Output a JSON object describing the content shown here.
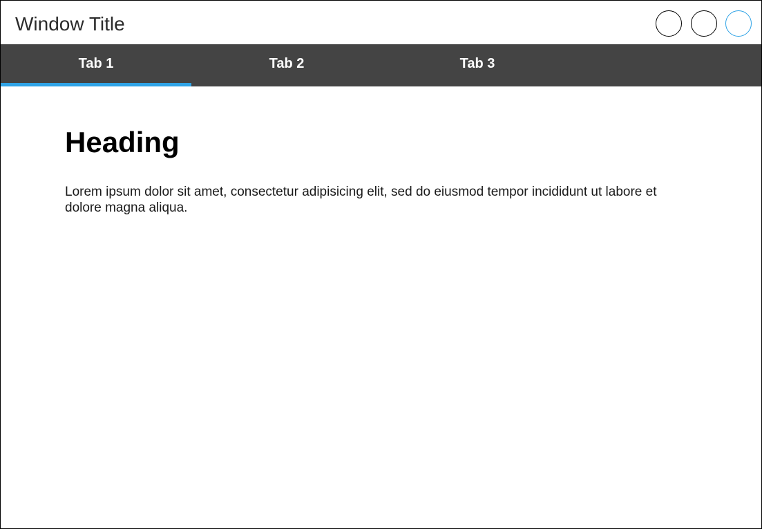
{
  "window": {
    "title": "Window Title",
    "controls": [
      "circle-button",
      "circle-button",
      "circle-button-active"
    ]
  },
  "tabs": [
    {
      "label": "Tab 1",
      "active": true
    },
    {
      "label": "Tab 2",
      "active": false
    },
    {
      "label": "Tab 3",
      "active": false
    }
  ],
  "main": {
    "heading": "Heading",
    "body": "Lorem ipsum dolor sit amet, consectetur adipisicing elit, sed do eiusmod tempor incididunt ut labore et dolore magna aliqua."
  },
  "colors": {
    "tabbar_bg": "#444444",
    "accent": "#2fa3e6",
    "window_border": "#000000"
  }
}
